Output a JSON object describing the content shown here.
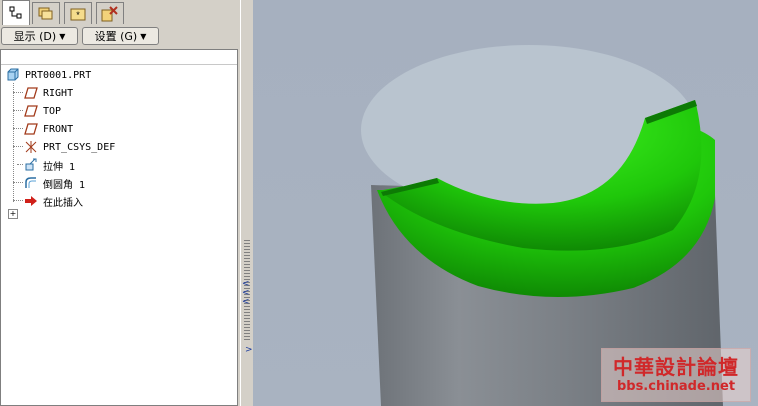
{
  "tabs": {
    "tab1_icon": "model-tree-icon",
    "tab2_icon": "folder-browser-icon",
    "tab3_icon": "favorites-folder-icon",
    "tab4_icon": "connections-icon"
  },
  "toolbar": {
    "show_label": "显示 (D)",
    "settings_label": "设置 (G)"
  },
  "tree": {
    "root": "PRT0001.PRT",
    "items": [
      {
        "label": "RIGHT",
        "icon": "datum-plane-icon"
      },
      {
        "label": "TOP",
        "icon": "datum-plane-icon"
      },
      {
        "label": "FRONT",
        "icon": "datum-plane-icon"
      },
      {
        "label": "PRT_CSYS_DEF",
        "icon": "csys-icon"
      },
      {
        "label": "拉伸 1",
        "icon": "extrude-icon"
      },
      {
        "label": "倒圆角 1",
        "icon": "round-icon"
      },
      {
        "label": "在此插入",
        "icon": "insert-here-arrow-icon"
      }
    ]
  },
  "watermark": {
    "line1": "中華設計論壇",
    "line2": "bbs.chinade.net"
  },
  "colors": {
    "round_green": "#1fcc0a",
    "top_face": "#b9c4cf",
    "cylinder": "#7a7f86",
    "background": "#a7b1bf"
  }
}
